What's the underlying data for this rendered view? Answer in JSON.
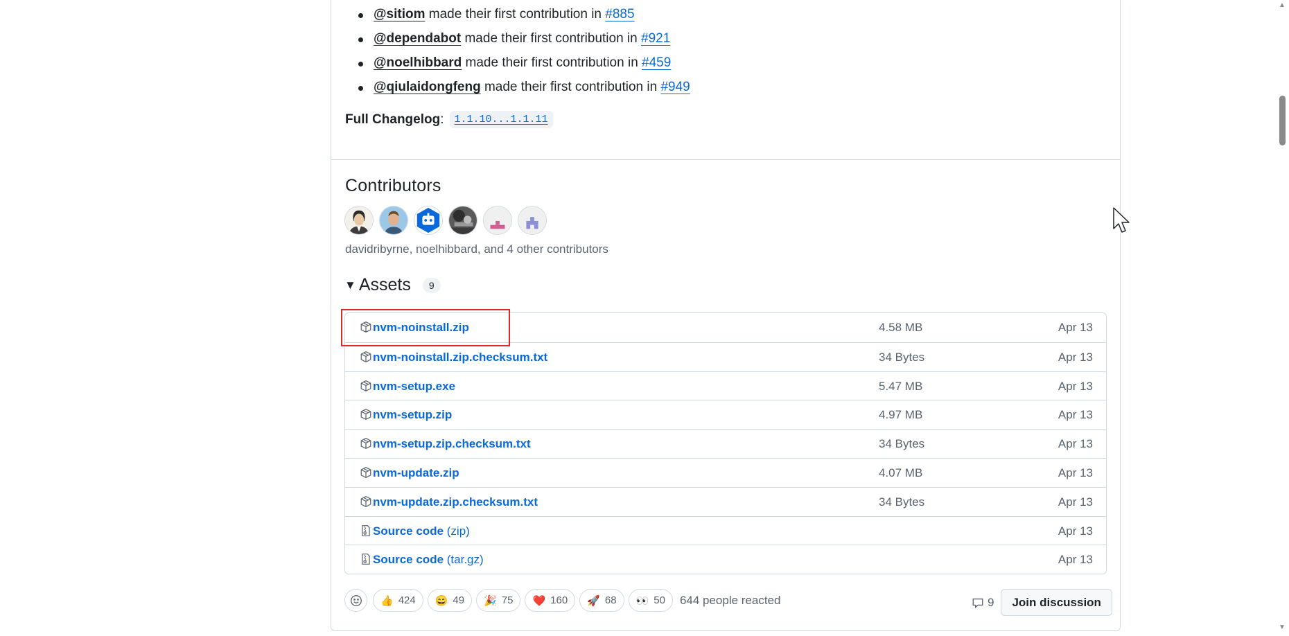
{
  "release_notes": {
    "contributions": [
      {
        "user": "@sitiom",
        "text": "made their first contribution in",
        "pr": "#885"
      },
      {
        "user": "@dependabot",
        "text": "made their first contribution in",
        "pr": "#921"
      },
      {
        "user": "@noelhibbard",
        "text": "made their first contribution in",
        "pr": "#459"
      },
      {
        "user": "@qiulaidongfeng",
        "text": "made their first contribution in",
        "pr": "#949"
      }
    ],
    "changelog_label": "Full Changelog",
    "changelog_sep": ":",
    "changelog_range": "1.1.10...1.1.11"
  },
  "contributors": {
    "title": "Contributors",
    "summary": "davidribyrne, noelhibbard, and 4 other contributors",
    "avatar_colors": [
      "#c9b89a",
      "#9cc8e8",
      "#0969da",
      "#4a4a4a",
      "#cf5f93",
      "#8c8ed6"
    ]
  },
  "assets": {
    "title": "Assets",
    "count": "9",
    "rows": [
      {
        "name": "nvm-noinstall.zip",
        "suffix": "",
        "size": "4.58 MB",
        "date": "Apr 13",
        "icon": "package-icon"
      },
      {
        "name": "nvm-noinstall.zip.checksum.txt",
        "suffix": "",
        "size": "34 Bytes",
        "date": "Apr 13",
        "icon": "package-icon"
      },
      {
        "name": "nvm-setup.exe",
        "suffix": "",
        "size": "5.47 MB",
        "date": "Apr 13",
        "icon": "package-icon"
      },
      {
        "name": "nvm-setup.zip",
        "suffix": "",
        "size": "4.97 MB",
        "date": "Apr 13",
        "icon": "package-icon"
      },
      {
        "name": "nvm-setup.zip.checksum.txt",
        "suffix": "",
        "size": "34 Bytes",
        "date": "Apr 13",
        "icon": "package-icon"
      },
      {
        "name": "nvm-update.zip",
        "suffix": "",
        "size": "4.07 MB",
        "date": "Apr 13",
        "icon": "package-icon"
      },
      {
        "name": "nvm-update.zip.checksum.txt",
        "suffix": "",
        "size": "34 Bytes",
        "date": "Apr 13",
        "icon": "package-icon"
      },
      {
        "name": "Source code",
        "suffix": " (zip)",
        "size": "",
        "date": "Apr 13",
        "icon": "file-zip-icon"
      },
      {
        "name": "Source code",
        "suffix": " (tar.gz)",
        "size": "",
        "date": "Apr 13",
        "icon": "file-zip-icon"
      }
    ]
  },
  "reactions": {
    "items": [
      {
        "emoji": "👍",
        "count": "424",
        "name": "thumbs-up"
      },
      {
        "emoji": "😄",
        "count": "49",
        "name": "laugh"
      },
      {
        "emoji": "🎉",
        "count": "75",
        "name": "hooray"
      },
      {
        "emoji": "❤️",
        "count": "160",
        "name": "heart"
      },
      {
        "emoji": "🚀",
        "count": "68",
        "name": "rocket"
      },
      {
        "emoji": "👀",
        "count": "50",
        "name": "eyes"
      }
    ],
    "summary": "644 people reacted"
  },
  "discussion": {
    "comment_count": "9",
    "join_label": "Join discussion"
  },
  "colors": {
    "link": "#0969da",
    "highlight": "#d92b2b",
    "border": "#d1d9e0"
  }
}
